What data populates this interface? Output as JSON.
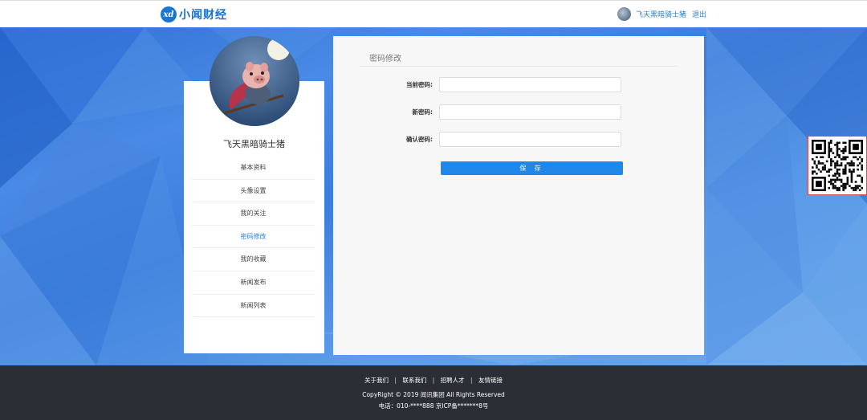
{
  "header": {
    "logo_mark": "xd",
    "logo_text": "小闻财经",
    "username": "飞天黑暗骑士猪",
    "logout_label": "退出"
  },
  "sidebar": {
    "name": "飞天黑暗骑士猪",
    "items": [
      {
        "label": "基本资料",
        "active": false
      },
      {
        "label": "头像设置",
        "active": false
      },
      {
        "label": "我的关注",
        "active": false
      },
      {
        "label": "密码修改",
        "active": true
      },
      {
        "label": "我的收藏",
        "active": false
      },
      {
        "label": "新闻发布",
        "active": false
      },
      {
        "label": "新闻列表",
        "active": false
      }
    ]
  },
  "form": {
    "title": "密码修改",
    "current_label": "当前密码:",
    "current_value": "",
    "new_label": "新密码:",
    "new_value": "",
    "confirm_label": "确认密码:",
    "confirm_value": "",
    "save_label": "保 存"
  },
  "footer": {
    "links": [
      "关于我们",
      "联系我们",
      "招聘人才",
      "友情链接"
    ],
    "separator": "|",
    "copyright": "CopyRight © 2019 闻讯集团 All Rights Reserved",
    "tel": "电话：010-****888 京ICP备*******8号"
  },
  "colors": {
    "accent": "#1f87ea",
    "link": "#2a7fd4",
    "footer_bg": "#2b2f35"
  },
  "icons": [
    "user-avatar",
    "pig-avatar",
    "qr-code"
  ]
}
